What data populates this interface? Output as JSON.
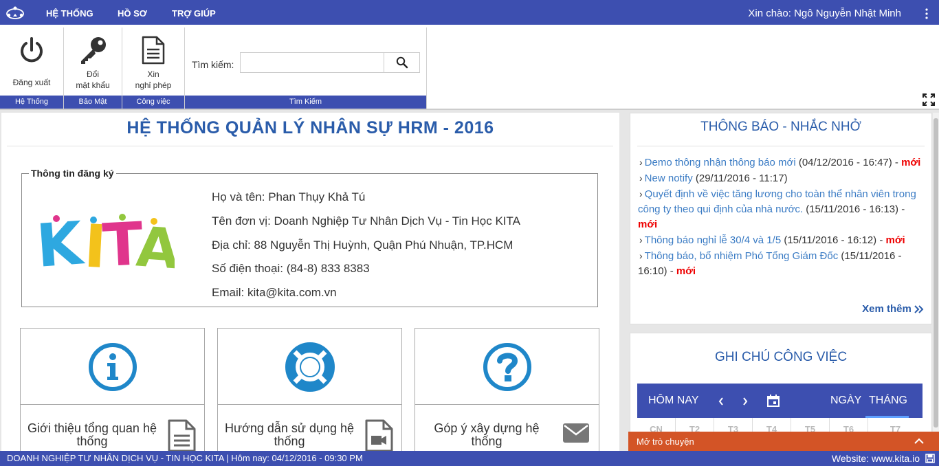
{
  "topbar": {
    "menu": [
      "HỆ THỐNG",
      "HỒ SƠ",
      "TRỢ GIÚP"
    ],
    "greeting": "Xin chào: Ngô Nguyễn Nhật Minh"
  },
  "ribbon": {
    "groups": [
      {
        "label": "Hệ Thống",
        "button": "Đăng xuất"
      },
      {
        "label": "Bảo Mật",
        "button_line1": "Đổi",
        "button_line2": "mật khẩu"
      },
      {
        "label": "Công việc",
        "button_line1": "Xin",
        "button_line2": "nghỉ phép"
      },
      {
        "label": "Tìm Kiếm"
      }
    ],
    "search_label": "Tìm kiếm:",
    "search_value": ""
  },
  "main": {
    "title": "HỆ THỐNG QUẢN LÝ NHÂN SỰ HRM - 2016",
    "registration": {
      "legend": "Thông tin đăng ký",
      "logo_text": "KITA",
      "lines": [
        "Họ và tên: Phan Thụy Khả Tú",
        "Tên đơn vị: Doanh Nghiệp Tư Nhân Dịch Vụ - Tin Học KITA",
        "Địa chỉ: 88 Nguyễn Thị Huỳnh, Quận Phú Nhuận, TP.HCM",
        "Số điện thoại: (84-8) 833 8383",
        "Email: kita@kita.com.vn"
      ]
    },
    "cards": [
      {
        "text": "Giới thiệu tổng quan hệ thống"
      },
      {
        "text": "Hướng dẫn sử dụng hệ thống"
      },
      {
        "text": "Góp ý xây dựng hệ thống"
      }
    ]
  },
  "notifications": {
    "title": "THÔNG BÁO - NHẮC NHỞ",
    "items": [
      {
        "link": "Demo thông nhận thông báo mới",
        "date": " (04/12/2016 - 16:47) - ",
        "new": "mới"
      },
      {
        "link": "New notify",
        "date": " (29/11/2016 - 11:17)",
        "new": ""
      },
      {
        "link": "Quyết định về việc tăng lương cho toàn thể nhân viên trong công ty theo qui định của nhà nước.",
        "date": " (15/11/2016 - 16:13) - ",
        "new": "mới"
      },
      {
        "link": "Thông báo nghỉ lễ 30/4 và 1/5",
        "date": " (15/11/2016 - 16:12) - ",
        "new": "mới"
      },
      {
        "link": "Thông báo, bổ nhiệm Phó Tổng Giám Đốc",
        "date": " (15/11/2016 - 16:10) - ",
        "new": "mới"
      }
    ],
    "see_more": "Xem thêm"
  },
  "notes": {
    "title": "GHI CHÚ CÔNG VIỆC",
    "today": "HÔM NAY",
    "day": "NGÀY",
    "month": "THÁNG",
    "weekdays": [
      "CN",
      "T2",
      "T3",
      "T4",
      "T5",
      "T6",
      "T7"
    ]
  },
  "chat": {
    "label": "Mở trò chuyện"
  },
  "footer": {
    "left": "DOANH NGHIỆP TƯ NHÂN DỊCH VỤ - TIN HỌC KITA | Hôm nay: 04/12/2016 - 09:30 PM",
    "right": "Website: www.kita.io"
  },
  "colors": {
    "primary": "#3d4fb0",
    "title_blue": "#2a5caa",
    "icon_blue": "#1f87c9",
    "new_red": "#ee0000",
    "chat_orange": "#d35426"
  }
}
